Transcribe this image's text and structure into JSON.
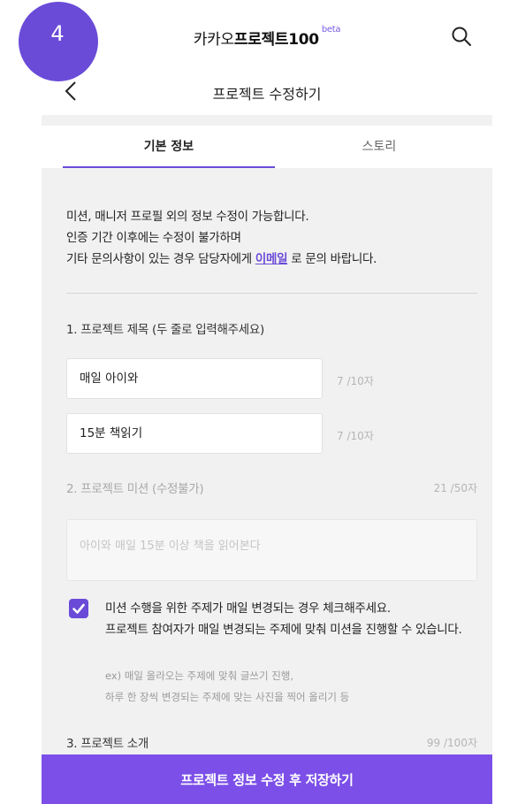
{
  "step_badge": "4",
  "header": {
    "brand_prefix": "카카오",
    "brand_bold": "프로젝트100",
    "brand_sup": "beta"
  },
  "navbar": {
    "title": "프로젝트 수정하기"
  },
  "tabs": [
    {
      "label": "기본 정보",
      "active": true
    },
    {
      "label": "스토리",
      "active": false
    }
  ],
  "notice": {
    "line1": "미션, 매니저 프로필 외의 정보 수정이 가능합니다.",
    "line2": "인증 기간 이후에는 수정이 불가하며",
    "line3_prefix": "기타 문의사항이 있는 경우 담당자에게 ",
    "email_link": "이메일",
    "line3_suffix": " 로 문의 바랍니다."
  },
  "project_title": {
    "label": "1. 프로젝트 제목 (두 줄로 입력해주세요)",
    "fields": [
      {
        "value": "매일 아이와",
        "counter": "7 /10자"
      },
      {
        "value": "15분 책읽기",
        "counter": "7 /10자"
      }
    ]
  },
  "mission": {
    "label": "2. 프로젝트 미션 (수정불가)",
    "counter": "21 /50자",
    "value": "아이와 매일 15분 이상 책을 읽어본다"
  },
  "daily_topic_option": {
    "checked": true,
    "line1": "미션 수행을 위한 주제가 매일 변경되는 경우 체크해주세요.",
    "line2": "프로젝트 참여자가 매일 변경되는 주제에 맞춰 미션을 진행할 수 있습니다.",
    "example1": "ex) 매일 올라오는 주제에 맞춰 글쓰기 진행,",
    "example2": "하루 한 장씩 변경되는 주제에 맞는 사진을 찍어 올리기 등"
  },
  "intro": {
    "label": "3. 프로젝트 소개",
    "counter": "99 /100자"
  },
  "save_button": "프로젝트 정보 수정 후 저장하기",
  "colors": {
    "accent": "#6a4bd8",
    "button": "#7b4fe8"
  }
}
